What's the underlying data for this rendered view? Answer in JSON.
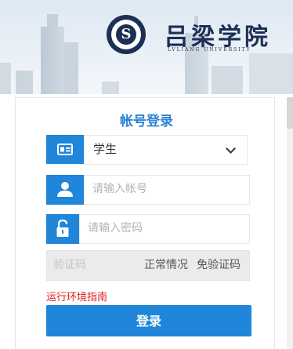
{
  "banner": {
    "school_name": "吕梁学院",
    "school_name_en": "LVLIANG UNIVERSITY",
    "logo_glyph": "S"
  },
  "login": {
    "title": "帐号登录",
    "role_select": {
      "value": "学生",
      "icon": "id-card-icon"
    },
    "account": {
      "placeholder": "请输入帐号",
      "icon": "user-icon"
    },
    "password": {
      "placeholder": "请输入密码",
      "icon": "lock-icon"
    },
    "captcha": {
      "placeholder": "验证码",
      "status": "正常情况",
      "free_text": "免验证码"
    },
    "env_guide": "运行环境指南",
    "submit": "登录"
  },
  "colors": {
    "accent": "#1f86d9",
    "title": "#2b84d4",
    "error": "#e02020",
    "logo": "#1c2f54"
  }
}
